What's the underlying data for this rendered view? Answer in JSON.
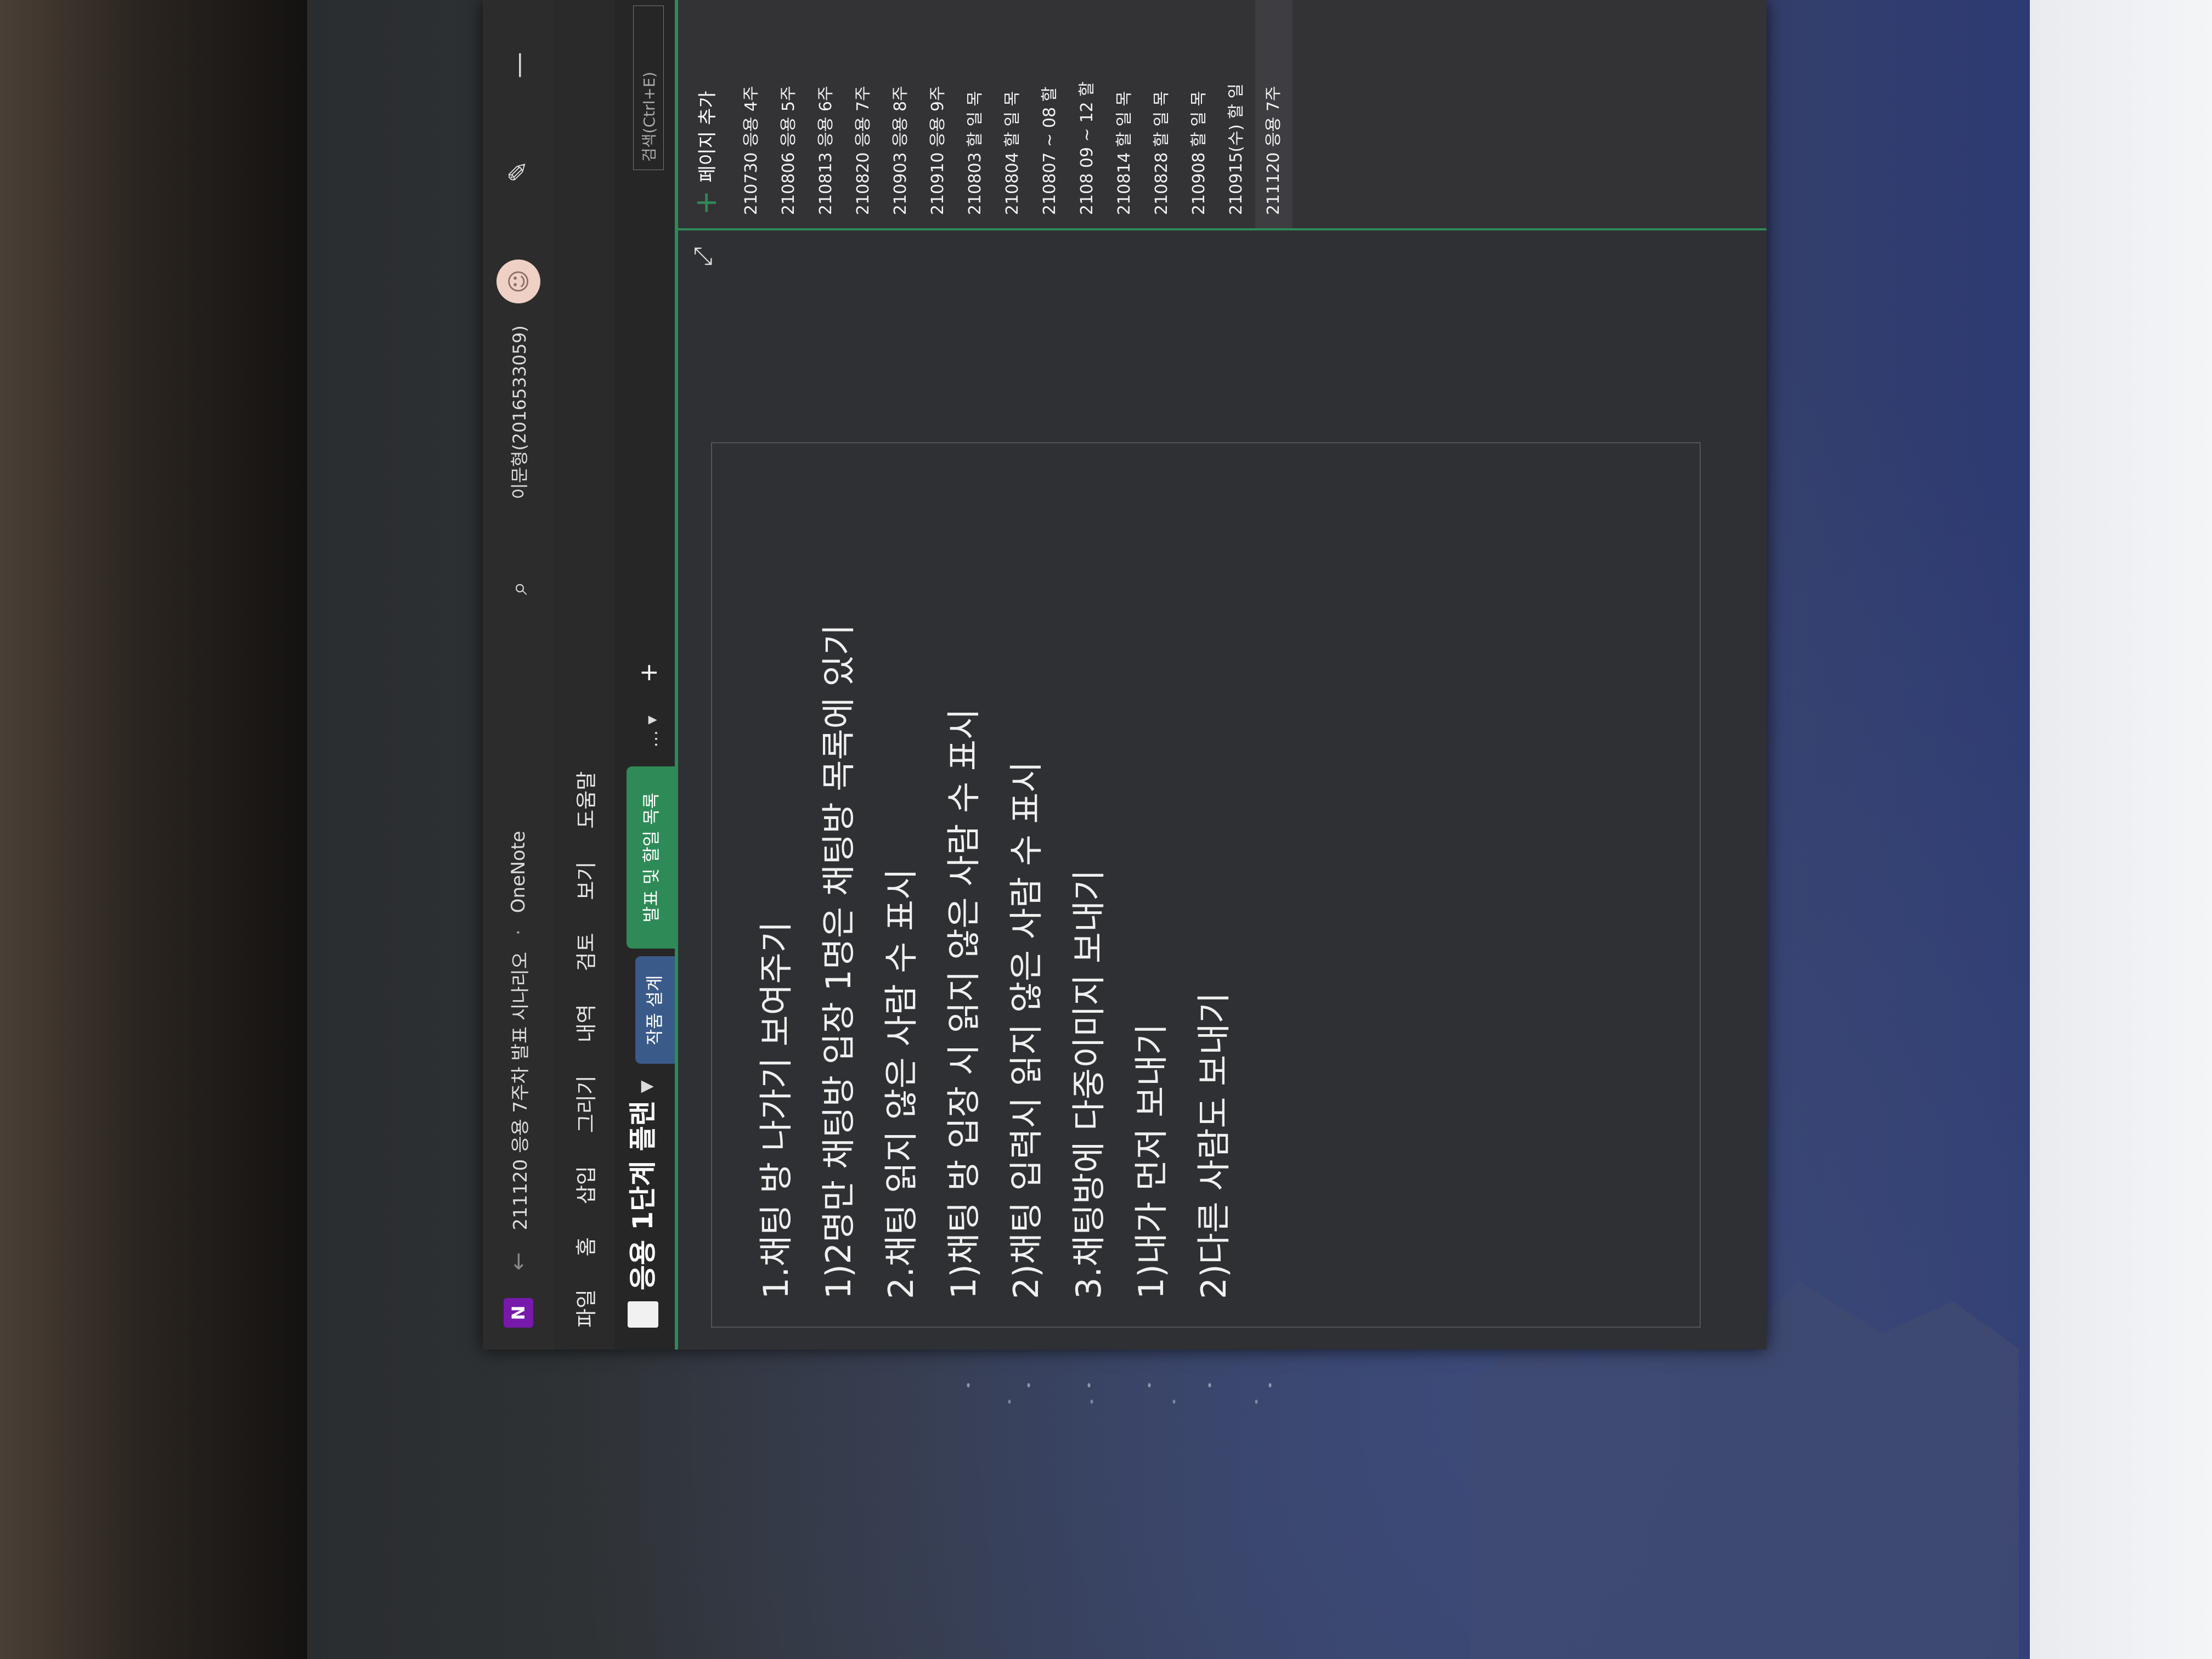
{
  "window": {
    "app_icon": "N",
    "back_icon": "←",
    "doc_title": "211120 응용 7주차 발표 시나리오",
    "app_name": "OneNote",
    "user": "이문형(2016533059)"
  },
  "menu": [
    "파일",
    "홈",
    "삽입",
    "그리기",
    "내역",
    "검토",
    "보기",
    "도움말"
  ],
  "notebook": {
    "name": "응용 1단계 플랜",
    "sections": [
      "작품 설계",
      "발표 및 할일 목록"
    ],
    "active_section": "발표 및 할일 목록",
    "more": "… ▾",
    "add": "+"
  },
  "search": {
    "placeholder": "검색(Ctrl+E)"
  },
  "note": {
    "lines": [
      "1.채팅 방 나가기 보여주기",
      "1)2명만 채팅방 입장  1명은 채팅방 목록에 있기",
      "",
      "2.채팅 읽지 않은 사람 수 표시",
      "",
      "1)채팅 방 입장 시 읽지 않은 사람 수 표시",
      "",
      "2)채팅 입력시 읽지 않은 사람 수 표시",
      "",
      "3.채팅방에 다중이미지 보내기",
      "1)내가 먼저 보내기",
      "",
      "2)다른 사람도 보내기"
    ]
  },
  "page_list": {
    "add_label": "페이지 추가",
    "items": [
      "210730 응용 4주",
      "210806  응용 5주",
      "210813 응용 6주",
      "210820 응용 7주",
      "210903 응용 8주",
      "210910 응용 9주",
      "210803 할 일 목",
      "210804 할 일 목",
      "210807 ~ 08 할",
      "2108 09 ~ 12 할",
      "210814 할 일 목",
      "210828 할 일 목",
      "210908 할 일 목",
      "210915(수) 할 일",
      "211120 응용 7주"
    ],
    "selected": 14
  },
  "icons": {
    "search": "search-icon",
    "pen": "pen-icon",
    "expand": "expand-icon",
    "minimize": "minimize-icon",
    "avatar": "avatar-icon"
  },
  "colors": {
    "accent": "#2e8b57",
    "brand": "#7719aa",
    "tab_blue": "#3a5a8a"
  }
}
